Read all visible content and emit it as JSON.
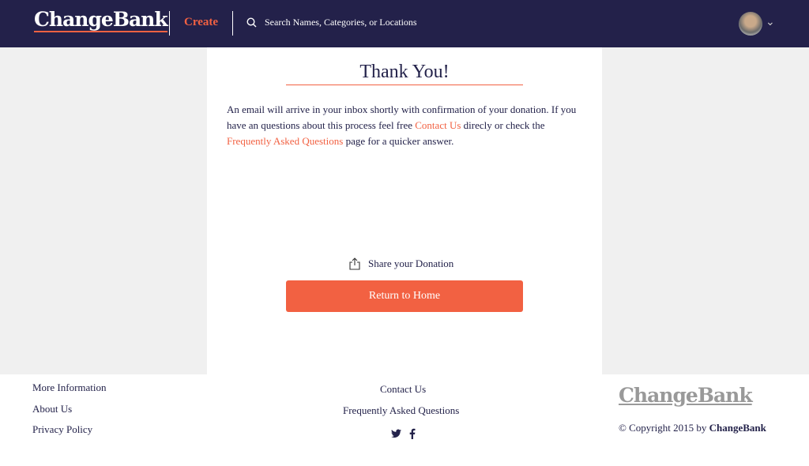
{
  "nav": {
    "logo": "ChangeBank",
    "create": "Create",
    "search_placeholder": "Search Names, Categories, or Locations"
  },
  "main": {
    "title": "Thank You!",
    "msg_1": "An email will arrive in your inbox shortly with confirmation of your donation. If you have an questions about this process feel free ",
    "contact_link": "Contact Us",
    "msg_2": " direcly or check the ",
    "faq_link": "Frequently Asked Questions",
    "msg_3": " page for a quicker answer.",
    "share": "Share your Donation",
    "return_button": "Return to Home"
  },
  "footer": {
    "left": [
      "More Information",
      "About Us",
      "Privacy Policy"
    ],
    "center": [
      "Contact Us",
      "Frequently Asked Questions"
    ],
    "logo": "ChangeBank",
    "copyright": "© Copyright 2015 by ",
    "copyright_brand": "ChangeBank"
  },
  "colors": {
    "nav": "#23214a",
    "accent": "#f26142"
  }
}
